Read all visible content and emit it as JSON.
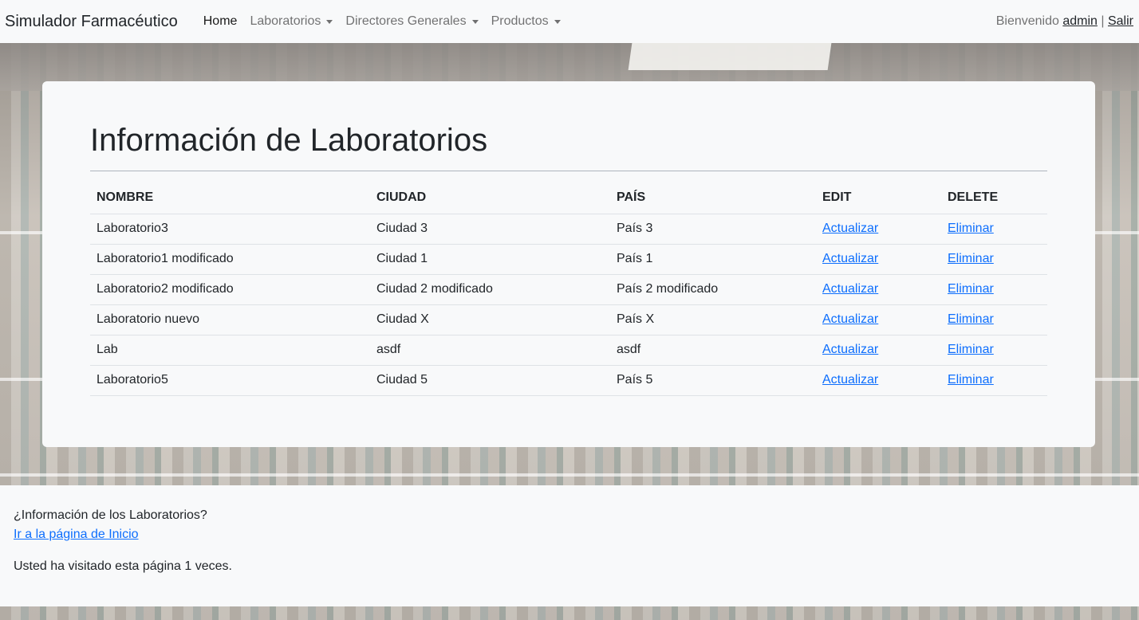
{
  "navbar": {
    "brand": "Simulador Farmacéutico",
    "items": [
      {
        "label": "Home",
        "dropdown": false
      },
      {
        "label": "Laboratorios",
        "dropdown": true
      },
      {
        "label": "Directores Generales",
        "dropdown": true
      },
      {
        "label": "Productos",
        "dropdown": true
      }
    ],
    "welcome": "Bienvenido",
    "user": "admin",
    "separator": "|",
    "logout": "Salir"
  },
  "main": {
    "title": "Información de Laboratorios",
    "columns": [
      "NOMBRE",
      "CIUDAD",
      "PAÍS",
      "EDIT",
      "DELETE"
    ],
    "rows": [
      {
        "nombre": "Laboratorio3",
        "ciudad": "Ciudad 3",
        "pais": "País 3",
        "edit": "Actualizar",
        "delete": "Eliminar"
      },
      {
        "nombre": "Laboratorio1 modificado",
        "ciudad": "Ciudad 1",
        "pais": "País 1",
        "edit": "Actualizar",
        "delete": "Eliminar"
      },
      {
        "nombre": "Laboratorio2 modificado",
        "ciudad": "Ciudad 2 modificado",
        "pais": "País 2 modificado",
        "edit": "Actualizar",
        "delete": "Eliminar"
      },
      {
        "nombre": "Laboratorio nuevo",
        "ciudad": "Ciudad X",
        "pais": "País X",
        "edit": "Actualizar",
        "delete": "Eliminar"
      },
      {
        "nombre": "Lab",
        "ciudad": "asdf",
        "pais": "asdf",
        "edit": "Actualizar",
        "delete": "Eliminar"
      },
      {
        "nombre": "Laboratorio5",
        "ciudad": "Ciudad 5",
        "pais": "País 5",
        "edit": "Actualizar",
        "delete": "Eliminar"
      }
    ]
  },
  "footer": {
    "question": "¿Información de los Laboratorios?",
    "home_link": "Ir a la página de Inicio",
    "visits": "Usted ha visitado esta página 1 veces."
  },
  "colors": {
    "link": "#0d6efd",
    "text": "#212529",
    "background": "#f8f9fa"
  }
}
